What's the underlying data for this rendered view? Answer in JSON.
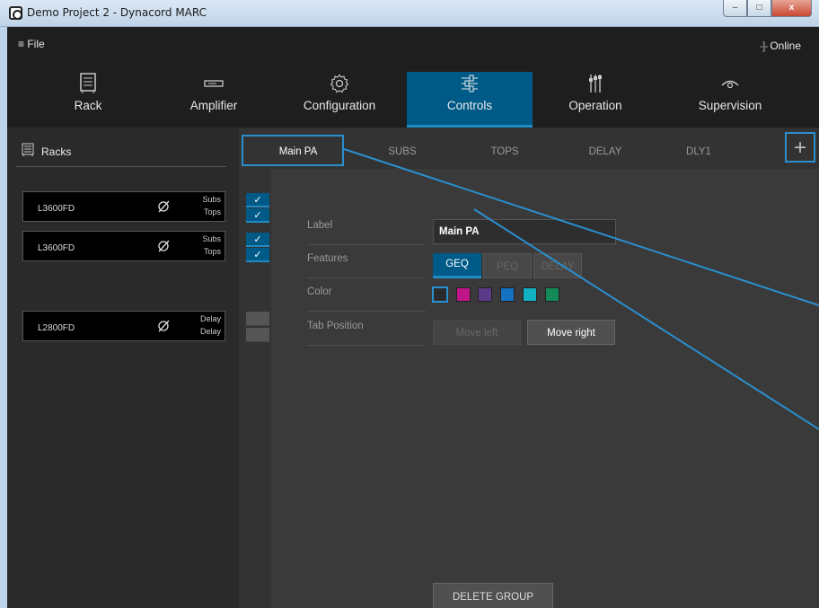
{
  "window": {
    "title": "Demo Project 2 - Dynacord MARC",
    "controls": {
      "minimize": "–",
      "maximize": "□",
      "close": "x"
    }
  },
  "menubar": {
    "file": "≡ File",
    "status": "Online",
    "status_icon": "-]-"
  },
  "nav": [
    {
      "label": "Rack",
      "icon": "rack-icon"
    },
    {
      "label": "Amplifier",
      "icon": "amplifier-icon"
    },
    {
      "label": "Configuration",
      "icon": "gear-icon"
    },
    {
      "label": "Controls",
      "icon": "sliders-icon",
      "active": true
    },
    {
      "label": "Operation",
      "icon": "faders-icon"
    },
    {
      "label": "Supervision",
      "icon": "eye-icon"
    }
  ],
  "sidebar": {
    "title": "Racks",
    "devices": [
      {
        "name": "L3600FD",
        "ch1": "Subs",
        "ch2": "Tops"
      },
      {
        "name": "L3600FD",
        "ch1": "Subs",
        "ch2": "Tops"
      },
      {
        "name": "L2800FD",
        "ch1": "Delay",
        "ch2": "Delay"
      }
    ],
    "checks": [
      "✓",
      "✓",
      "✓",
      "✓",
      "",
      ""
    ]
  },
  "tabs": [
    "Main PA",
    "SUBS",
    "TOPS",
    "DELAY",
    "DLY1"
  ],
  "add_tab": "+",
  "form": {
    "label_caption": "Label",
    "label_value": "Main PA",
    "features_caption": "Features",
    "features": [
      "GEQ",
      "PEQ",
      "DELAY"
    ],
    "color_caption": "Color",
    "colors": [
      "#2b2b2b",
      "#c0168a",
      "#5c3a8a",
      "#1572c0",
      "#14b1c4",
      "#138a57"
    ],
    "tab_position_caption": "Tab Position",
    "move_left": "Move left",
    "move_right": "Move right",
    "delete_group": "DELETE GROUP"
  }
}
